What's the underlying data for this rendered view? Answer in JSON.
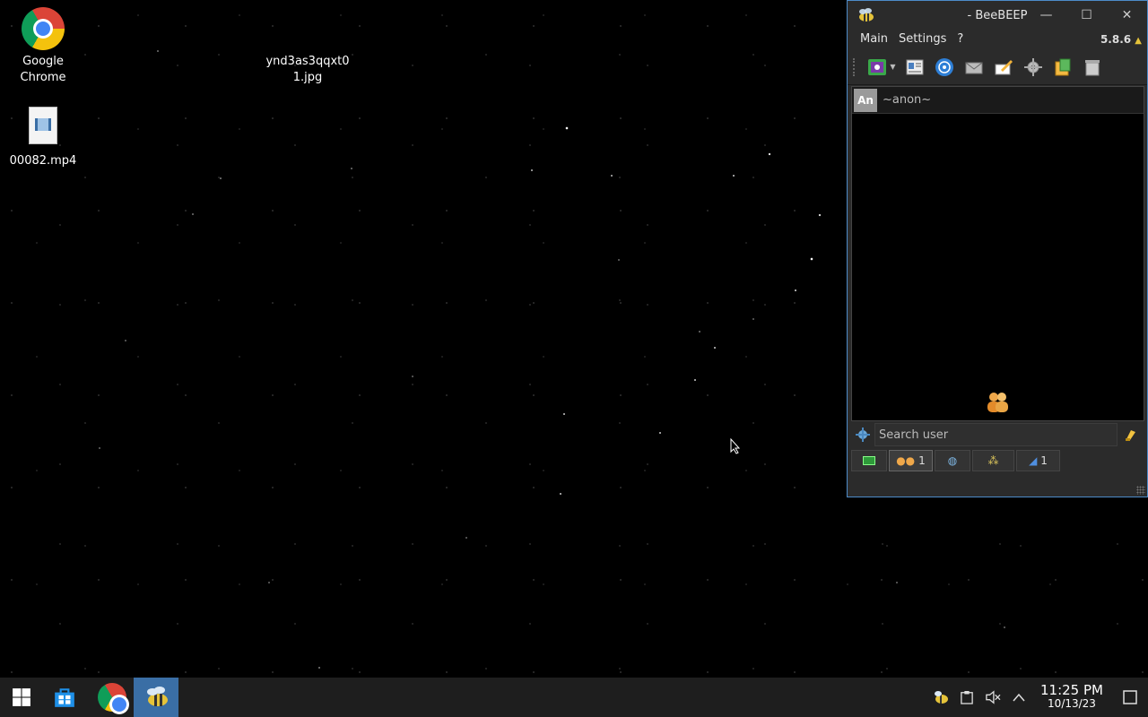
{
  "desktop": {
    "icons": [
      {
        "label_line1": "Google",
        "label_line2": "Chrome",
        "icon": "chrome-icon"
      },
      {
        "label_line1": "00082.mp4",
        "icon": "video-file-icon"
      },
      {
        "label_line1": "ynd3as3qqxt0",
        "label_line2": "1.jpg",
        "icon": "image-file-icon"
      }
    ]
  },
  "beebeep": {
    "title": "- BeeBEEP",
    "window_controls": {
      "minimize": "—",
      "maximize": "☐",
      "close": "✕"
    },
    "menu": [
      "Main",
      "Settings",
      "?"
    ],
    "version": "5.8.6",
    "toolbar": [
      "status-icon",
      "profile-icon",
      "network-icon",
      "message-icon",
      "write-icon",
      "plugins-icon",
      "file-sharing-icon",
      "trash-icon"
    ],
    "users": [
      {
        "avatar": "An",
        "name": "~anon~"
      }
    ],
    "search": {
      "placeholder": "Search user",
      "value": ""
    },
    "tabs": [
      {
        "icon": "home-icon",
        "count": ""
      },
      {
        "icon": "users-icon",
        "count": "1"
      },
      {
        "icon": "chats-icon",
        "count": ""
      },
      {
        "icon": "groups-icon",
        "count": ""
      },
      {
        "icon": "files-icon",
        "count": "1"
      }
    ]
  },
  "taskbar": {
    "clock_time": "11:25 PM",
    "clock_date": "10/13/23"
  }
}
